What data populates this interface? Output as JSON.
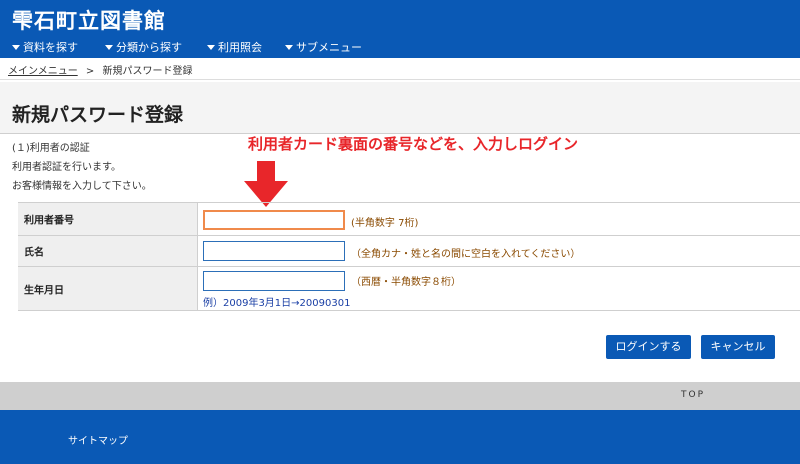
{
  "header": {
    "site_title": "雫石町立図書館",
    "nav": [
      {
        "label": "資料を探す"
      },
      {
        "label": "分類から探す"
      },
      {
        "label": "利用照会"
      },
      {
        "label": "サブメニュー"
      }
    ]
  },
  "breadcrumb": {
    "home": "メインメニュー",
    "separator": ">",
    "current": "新規パスワード登録"
  },
  "page_title": "新規パスワード登録",
  "intro": {
    "line1": "(１)利用者の認証",
    "line2": "利用者認証を行います。",
    "line3": "お客様情報を入力して下さい。"
  },
  "annotation": {
    "text": "利用者カード裏面の番号などを、入力しログイン",
    "color": "#e8262a"
  },
  "form": {
    "user_number": {
      "label": "利用者番号",
      "value": "",
      "hint": "(半角数字 7桁)"
    },
    "name": {
      "label": "氏名",
      "value": "",
      "hint": "（全角カナ・姓と名の間に空白を入れてください）"
    },
    "birthdate": {
      "label": "生年月日",
      "value": "",
      "hint": "（西暦・半角数字８桁）",
      "example": "例）2009年3月1日→20090301"
    }
  },
  "buttons": {
    "login": "ログインする",
    "cancel": "キャンセル"
  },
  "footer": {
    "top_link": "TOP",
    "sitemap": "サイトマップ"
  },
  "colors": {
    "brand": "#0a59b5",
    "annotation": "#e8262a",
    "active_field_border": "#f08a4b"
  }
}
